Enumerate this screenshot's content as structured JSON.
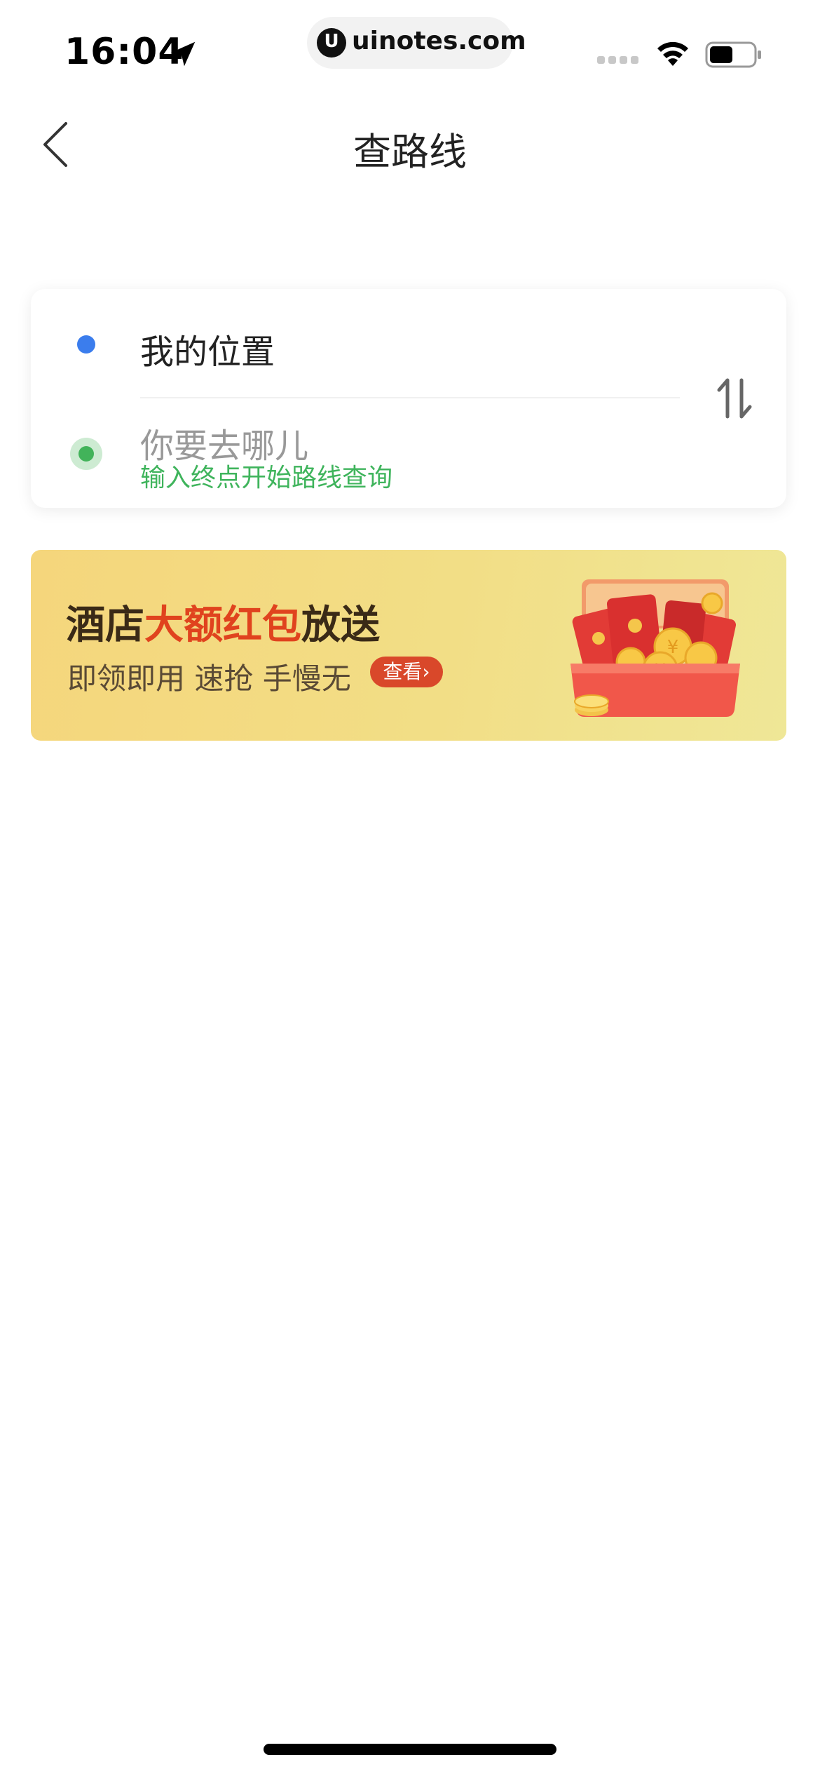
{
  "status_bar": {
    "time": "16:04",
    "url": "uinotes.com",
    "url_logo_letter": "U",
    "icons": [
      "location-arrow-icon",
      "signal-icon",
      "wifi-icon",
      "battery-icon"
    ]
  },
  "nav": {
    "title": "查路线",
    "back_icon": "back-icon"
  },
  "route": {
    "start_label": "我的位置",
    "end_placeholder": "你要去哪儿",
    "end_hint": "输入终点开始路线查询",
    "swap_icon": "swap-icon",
    "colors": {
      "start_dot": "#3b7ded",
      "end_dot": "#42b35a",
      "hint": "#3fb45c"
    }
  },
  "banner": {
    "title_part1": "酒店",
    "title_highlight": "大额红包",
    "title_part2": "放送",
    "subtitle": "即领即用 速抢 手慢无",
    "button_label": "查看",
    "button_chevron": "›",
    "image": "red-envelope-chest-icon",
    "colors": {
      "highlight": "#e0431e",
      "button": "#d9482a",
      "background": "#f5d67c"
    }
  }
}
